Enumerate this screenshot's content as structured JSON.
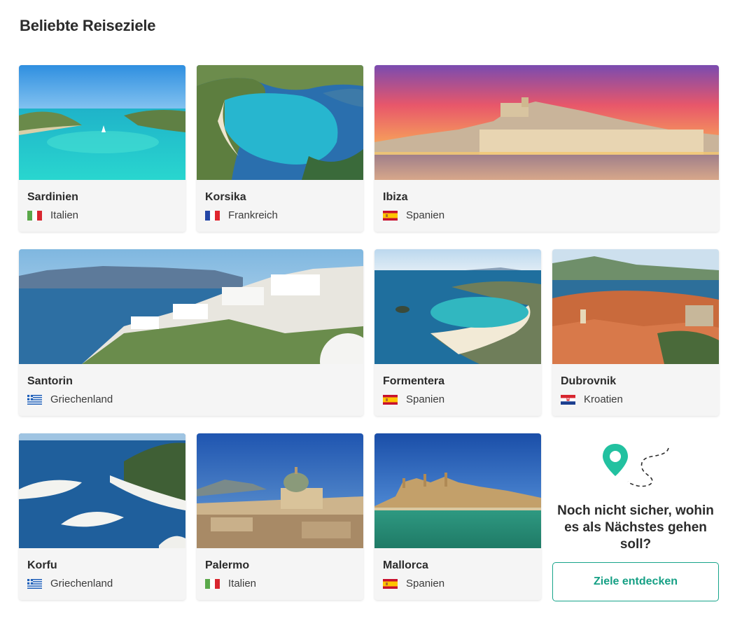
{
  "section": {
    "title": "Beliebte Reiseziele"
  },
  "destinations": [
    {
      "name": "Sardinien",
      "country": "Italien",
      "flag": "italy-flag"
    },
    {
      "name": "Korsika",
      "country": "Frankreich",
      "flag": "france-flag"
    },
    {
      "name": "Ibiza",
      "country": "Spanien",
      "flag": "spain-flag"
    },
    {
      "name": "Santorin",
      "country": "Griechenland",
      "flag": "greece-flag"
    },
    {
      "name": "Formentera",
      "country": "Spanien",
      "flag": "spain-flag"
    },
    {
      "name": "Dubrovnik",
      "country": "Kroatien",
      "flag": "croatia-flag"
    },
    {
      "name": "Korfu",
      "country": "Griechenland",
      "flag": "greece-flag"
    },
    {
      "name": "Palermo",
      "country": "Italien",
      "flag": "italy-flag"
    },
    {
      "name": "Mallorca",
      "country": "Spanien",
      "flag": "spain-flag"
    }
  ],
  "cta": {
    "text": "Noch nicht sicher, wohin es als Nächstes gehen soll?",
    "button_label": "Ziele entdecken",
    "icon": "map-pin-route-icon"
  },
  "colors": {
    "accent": "#17a48a",
    "card_background": "#f5f5f5",
    "text": "#2b2b2b"
  }
}
